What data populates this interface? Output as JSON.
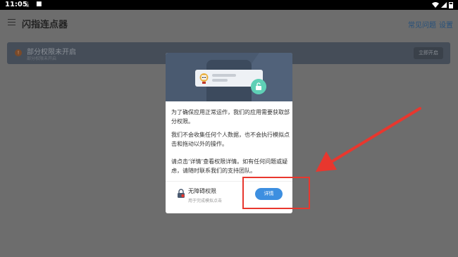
{
  "status_bar": {
    "time": "11:05"
  },
  "app_bar": {
    "title": "闪指连点器",
    "faq_link": "常见问题",
    "settings_link": "设置"
  },
  "banner": {
    "title": "部分权限未开启",
    "subtitle": "部分权限未开启",
    "button": "立即开启"
  },
  "dialog": {
    "paragraphs": [
      "为了确保应用正常运作，我们的应用需要获取部分权限。",
      "我们不会收集任何个人数据，也不会执行模拟点击和拖动以外的操作。",
      "请点击‘详情’查看权限详情。如有任何问题或疑虑，请随时联系我们的支持团队。"
    ],
    "permission": {
      "title": "无障碍权限",
      "subtitle": "用于完成模拟点击",
      "button": "详情"
    }
  },
  "colors": {
    "accent": "#3d8fe0",
    "hero_bg": "#4a5a70",
    "lock_badge": "#5fd0b6",
    "annotation": "#e8372e"
  }
}
